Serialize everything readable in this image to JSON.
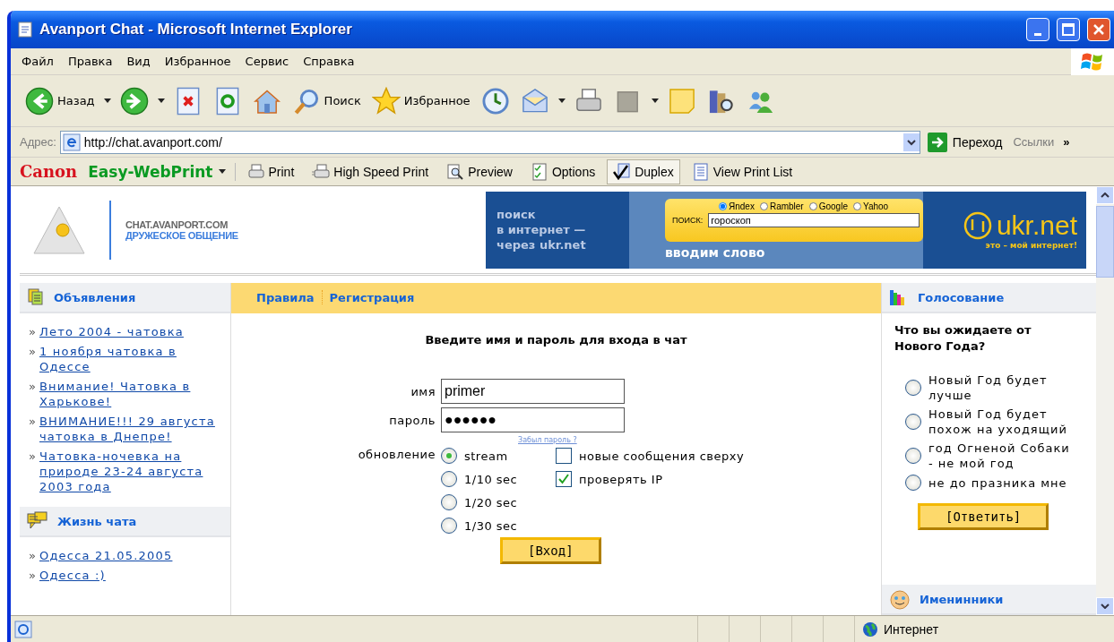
{
  "window": {
    "title": "Avanport Chat - Microsoft Internet Explorer"
  },
  "menu": [
    {
      "label": "Файл"
    },
    {
      "label": "Правка"
    },
    {
      "label": "Вид"
    },
    {
      "label": "Избранное"
    },
    {
      "label": "Сервис"
    },
    {
      "label": "Справка"
    }
  ],
  "toolbar": [
    {
      "kind": "back",
      "label": "Назад",
      "dropdown": true
    },
    {
      "kind": "forward",
      "dropdown": true
    },
    {
      "kind": "stop"
    },
    {
      "kind": "refresh"
    },
    {
      "kind": "home"
    },
    {
      "kind": "search",
      "label": "Поиск"
    },
    {
      "kind": "favorites",
      "label": "Избранное"
    },
    {
      "kind": "history"
    },
    {
      "kind": "mail",
      "dropdown": true
    },
    {
      "kind": "print"
    },
    {
      "kind": "edit",
      "dropdown": true
    },
    {
      "kind": "note"
    },
    {
      "kind": "research"
    },
    {
      "kind": "messenger"
    }
  ],
  "address": {
    "label": "Адрес:",
    "url": "http://chat.avanport.com/",
    "go": "Переход",
    "links": "Ссылки",
    "more": "»"
  },
  "print_bar": {
    "brand": "Canon",
    "product": "Easy-WebPrint",
    "buttons": [
      {
        "kind": "print",
        "label": "Print",
        "pressed": false
      },
      {
        "kind": "speed",
        "label": "High Speed Print",
        "pressed": false
      },
      {
        "kind": "preview",
        "label": "Preview",
        "pressed": false
      },
      {
        "kind": "options",
        "label": "Options",
        "pressed": false
      },
      {
        "kind": "duplex",
        "label": "Duplex",
        "pressed": true
      },
      {
        "kind": "list",
        "label": "View Print List",
        "pressed": false
      }
    ]
  },
  "site": {
    "name": "CHAT.AVANPORT.COM",
    "tagline": "ДРУЖЕСКОЕ ОБЩЕНИЕ"
  },
  "banner": {
    "lines": [
      "поиск",
      "в интернет —",
      "через ukr.net"
    ],
    "engines": [
      {
        "label": "Яndex",
        "selected": true
      },
      {
        "label": "Rambler",
        "selected": false
      },
      {
        "label": "Google",
        "selected": false
      },
      {
        "label": "Yahoo",
        "selected": false
      }
    ],
    "search_label": "ПОИСК:",
    "search_value": "гороскоп",
    "caption": "вводим слово",
    "brand": "ukr.net",
    "slogan": "это – мой интернет!"
  },
  "sidebar": [
    {
      "kind": "announcements",
      "title": "Объявления",
      "links": [
        {
          "marker": "»",
          "text": "Лето 2004 - чатовка"
        },
        {
          "marker": "»",
          "text": "1 ноября чатовка в Одессе"
        },
        {
          "marker": "»",
          "text": "Внимание! Чатовка в Харькове!"
        },
        {
          "marker": "»",
          "text": "ВНИМАНИЕ!!! 29 августа чатовка в Днепре!"
        },
        {
          "marker": "»",
          "text": "Чатовка-ночевка на природе 23-24 августа 2003 года"
        }
      ]
    },
    {
      "kind": "chat_life",
      "title": "Жизнь чата",
      "links": [
        {
          "marker": "»",
          "text": "Одесса 21.05.2005"
        },
        {
          "marker": "»",
          "text": "Одесса :)"
        }
      ]
    }
  ],
  "nav": [
    {
      "label": "Правила"
    },
    {
      "label": "Регистрация"
    }
  ],
  "login": {
    "heading": "Введите имя и пароль для входа в чат",
    "fields": [
      {
        "label": "имя",
        "value": "primer"
      },
      {
        "label": "пароль",
        "value": "●●●●●●"
      }
    ],
    "forgot": "Забыл пароль ?",
    "update_label": "обновление",
    "update_options": [
      {
        "label": "stream",
        "selected": true
      },
      {
        "label": "1/10 sec",
        "selected": false
      },
      {
        "label": "1/20 sec",
        "selected": false
      },
      {
        "label": "1/30 sec",
        "selected": false
      }
    ],
    "checkboxes": [
      {
        "label": "новые сообщения сверху",
        "checked": false
      },
      {
        "label": "проверять IP",
        "checked": true
      }
    ],
    "submit": "[Вход]"
  },
  "poll": {
    "title": "Голосование",
    "question": "Что вы ожидаете от Нового Года?",
    "options": [
      {
        "label": "Новый Год будет лучше",
        "selected": false
      },
      {
        "label": "Новый Год будет похож на уходящий",
        "selected": false
      },
      {
        "label": "год Огненой Собаки - не мой год",
        "selected": false
      },
      {
        "label": "не до празника мне",
        "selected": false
      }
    ],
    "submit": "[Ответить]"
  },
  "next_section": {
    "title": "Именинники"
  },
  "status_bar": {
    "zone": "Интернет"
  }
}
